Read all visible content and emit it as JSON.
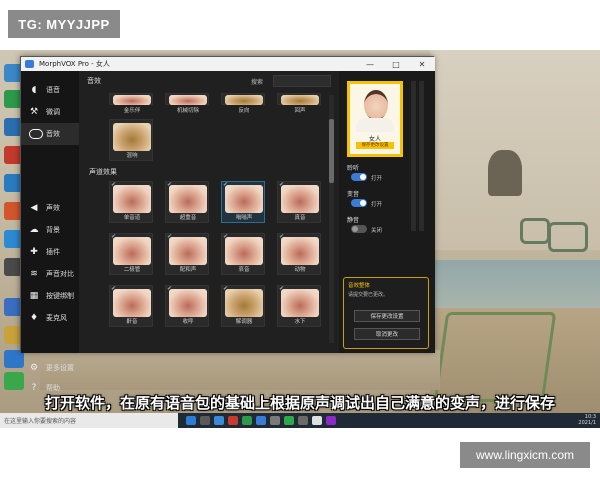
{
  "watermarks": {
    "top": "TG: MYYJJPP",
    "bottom": "www.lingxicm.com"
  },
  "window": {
    "title": "MorphVOX Pro - 女人",
    "controls": [
      "—",
      "□",
      "✕"
    ]
  },
  "sidebar": {
    "items": [
      {
        "label": "语音",
        "icon": "voice-icon"
      },
      {
        "label": "微调",
        "icon": "tools-icon"
      },
      {
        "label": "音效",
        "icon": "toggle-icon"
      },
      {
        "label": "声效",
        "icon": "speaker-icon"
      },
      {
        "label": "背景",
        "icon": "cloud-icon"
      },
      {
        "label": "插件",
        "icon": "puzzle-icon"
      },
      {
        "label": "声音对比",
        "icon": "compare-icon"
      },
      {
        "label": "按键绑制",
        "icon": "keyboard-icon"
      },
      {
        "label": "麦克风",
        "icon": "microphone-icon"
      },
      {
        "label": "更多设置",
        "icon": "settings-icon"
      },
      {
        "label": "帮助",
        "icon": "help-icon"
      }
    ],
    "active_index": 2
  },
  "content": {
    "title": "音效",
    "search_label": "搜索",
    "search_placeholder": "",
    "top_row": [
      "金乐伴",
      "机械切除",
      "反向",
      "回声"
    ],
    "top_single": "混响",
    "section_title": "声道效果",
    "grid": [
      [
        "单音道",
        "超重音",
        "嗡嗡声",
        "真音"
      ],
      [
        "二极管",
        "配和声",
        "哀音",
        "动物"
      ],
      [
        "鼾音",
        "收呼",
        "解调器",
        "水下"
      ]
    ],
    "selected": "嗡嗡声"
  },
  "right_panel": {
    "voice_name": "女人",
    "voice_button": "保存更改设置",
    "options": [
      {
        "label": "聆听",
        "state": "打开",
        "on": true
      },
      {
        "label": "变音",
        "state": "打开",
        "on": true
      },
      {
        "label": "静音",
        "state": "关闭",
        "on": false
      }
    ],
    "save_panel": {
      "title": "音效整体",
      "message": "请提交要已更改。",
      "save_button": "保存更改设置",
      "cancel_button": "取消更改"
    }
  },
  "subtitle": "打开软件，在原有语音包的基础上根据原声调试出自己满意的变声，进行保存",
  "taskbar": {
    "search_placeholder": "在这里输入你要搜索的内容",
    "clock_time": "10:3",
    "clock_date": "2021/1"
  },
  "colors": {
    "accent_blue": "#3a7bd5",
    "accent_yellow": "#f5c400",
    "app_bg": "#1c1c1c"
  }
}
